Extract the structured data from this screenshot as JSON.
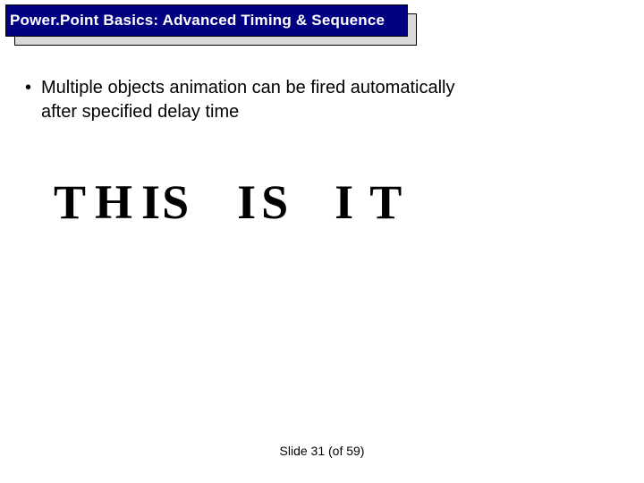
{
  "header": {
    "title": "Power.Point Basics: Advanced Timing & Sequence"
  },
  "body": {
    "bullet_marker": "•",
    "bullet_line1": "Multiple objects animation can be fired automatically",
    "bullet_line2": "after specified delay time"
  },
  "letters": {
    "l1": "T",
    "l2": "H",
    "l3": "I",
    "l4": "S",
    "l5": "I",
    "l6": "S",
    "l7": "I",
    "l8": "T"
  },
  "footer": {
    "text": "Slide  31 (of  59)"
  }
}
